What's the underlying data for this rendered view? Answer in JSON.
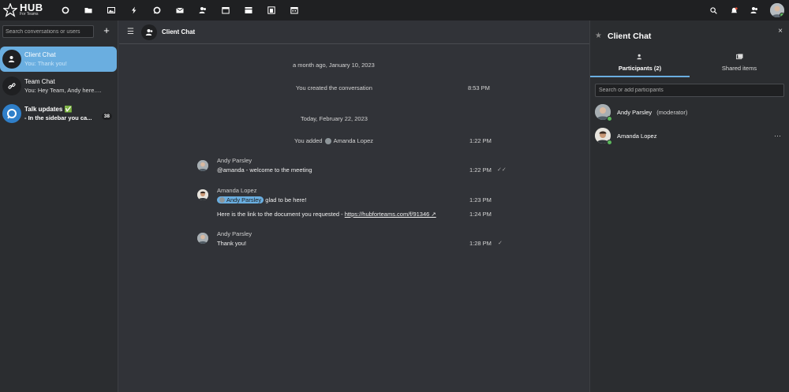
{
  "app": {
    "logo_text": "HUB",
    "logo_sub": "For Teams"
  },
  "topbar": {
    "icons": [
      "circle-icon",
      "folder-icon",
      "image-icon",
      "lightning-icon",
      "talk-icon",
      "mail-icon",
      "contacts-icon",
      "calendar-icon",
      "deck-icon",
      "tables-icon",
      "calendar-alt-icon"
    ],
    "right_icons": [
      "search-icon",
      "notification-icon",
      "contacts-menu-icon"
    ]
  },
  "sidebar": {
    "search_placeholder": "Search conversations or users",
    "add_label": "+",
    "conversations": [
      {
        "name": "Client Chat",
        "preview": "You: Thank you!",
        "active": true
      },
      {
        "name": "Team Chat",
        "preview": "You: Hey Team, Andy here. L...",
        "active": false
      },
      {
        "name": "Talk updates ✅",
        "preview": "- In the sidebar you ca...",
        "badge": "38",
        "active": false
      }
    ]
  },
  "chat": {
    "title": "Client Chat",
    "system": {
      "date1": "a month ago, January 10, 2023",
      "created": "You created the conversation",
      "created_time": "8:53 PM",
      "date2": "Today, February 22, 2023",
      "added_prefix": "You added",
      "added_name": "Amanda Lopez",
      "added_time": "1:22 PM"
    },
    "messages": [
      {
        "author": "Andy Parsley",
        "text": "@amanda - welcome to the meeting",
        "time": "1:22 PM",
        "tick": "✓✓"
      },
      {
        "author": "Amanda Lopez",
        "mention": "Andy Parsley",
        "text": "glad to be here!",
        "time": "1:23 PM"
      },
      {
        "text": "Here is the link to the document you requested -",
        "link": "https://hubforteams.com/f/91346 ↗",
        "time": "1:24 PM"
      },
      {
        "author": "Andy Parsley",
        "text": "Thank you!",
        "time": "1:28 PM",
        "tick": "✓"
      }
    ]
  },
  "panel": {
    "title": "Client Chat",
    "close": "×",
    "tabs": [
      {
        "label": "Participants (2)",
        "active": true
      },
      {
        "label": "Shared items",
        "active": false
      }
    ],
    "search_placeholder": "Search or add participants",
    "participants": [
      {
        "name": "Andy Parsley",
        "role": "(moderator)"
      },
      {
        "name": "Amanda Lopez",
        "role": "",
        "more": "···"
      }
    ]
  },
  "colors": {
    "accent": "#6aaee0",
    "online": "#5cb85c",
    "background": "#313338",
    "topbar": "#1f2022"
  }
}
